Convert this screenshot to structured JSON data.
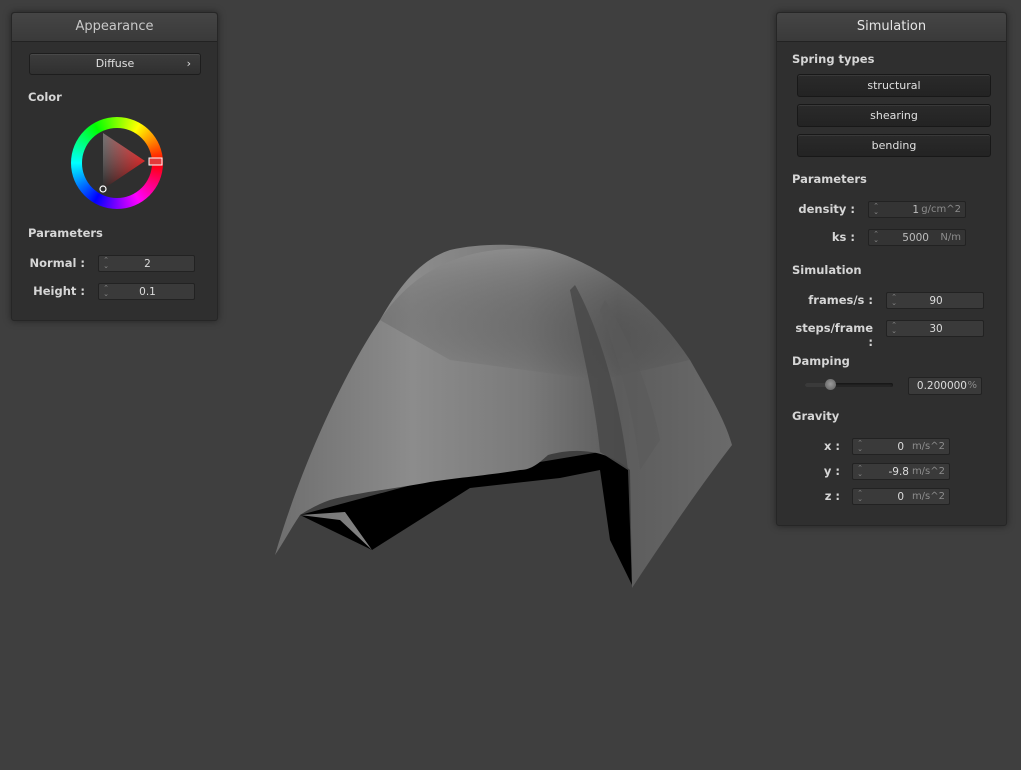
{
  "appearance": {
    "title": "Appearance",
    "shader_dropdown": {
      "label": "Diffuse",
      "arrow": "›"
    },
    "color_label": "Color",
    "parameters_label": "Parameters",
    "fields": [
      {
        "label": "Normal :",
        "value": "2"
      },
      {
        "label": "Height :",
        "value": "0.1"
      }
    ],
    "selected_hue_color": "#ff0000"
  },
  "simulation": {
    "title": "Simulation",
    "spring_types_label": "Spring types",
    "spring_buttons": [
      "structural",
      "shearing",
      "bending"
    ],
    "parameters_label": "Parameters",
    "parameters": [
      {
        "label": "density :",
        "value": "1",
        "unit": "g/cm^2"
      },
      {
        "label": "ks :",
        "value": "5000",
        "unit": "N/m"
      }
    ],
    "simulation_label": "Simulation",
    "sim_fields": [
      {
        "label": "frames/s :",
        "value": "90"
      },
      {
        "label": "steps/frame :",
        "value": "30"
      }
    ],
    "damping_label": "Damping",
    "damping": {
      "value": "0.200000",
      "unit": "%",
      "slider_fraction": 0.2
    },
    "gravity_label": "Gravity",
    "gravity": [
      {
        "label": "x :",
        "value": "0",
        "unit": "m/s^2"
      },
      {
        "label": "y :",
        "value": "-9.8",
        "unit": "m/s^2"
      },
      {
        "label": "z :",
        "value": "0",
        "unit": "m/s^2"
      }
    ]
  },
  "colors": {
    "background": "#3f3f3f",
    "panel": "#2f2f2f",
    "cloth": "#808080"
  }
}
